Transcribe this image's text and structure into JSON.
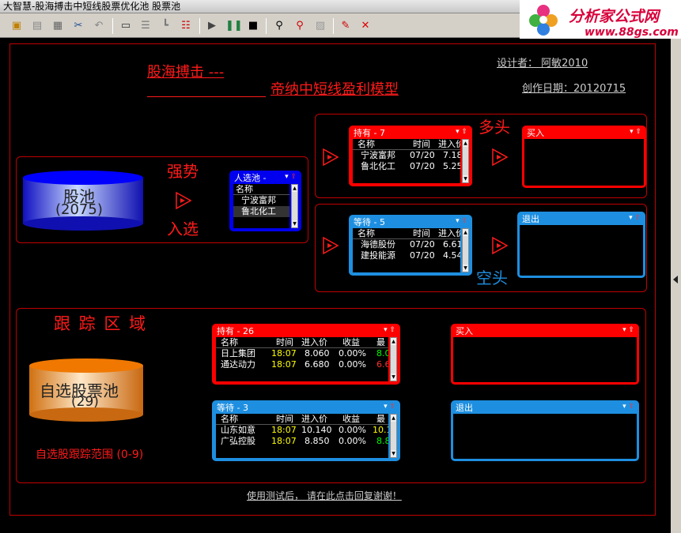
{
  "window": {
    "title": "大智慧-股海搏击中短线股票优化池 股票池"
  },
  "logo": {
    "name": "分析家公式网",
    "url": "www.88gs.com"
  },
  "header": {
    "title_line1": "股海搏击 ---",
    "title_line2": "帝纳中短线盈利模型",
    "designer": "设计者： 阿敏2010",
    "created": "创作日期：20120715"
  },
  "pool": {
    "name": "股池",
    "count": "(2075)",
    "strong_label": "强势",
    "enter_label": "入选"
  },
  "selected_panel": {
    "title": "人选池 -",
    "header": "名称",
    "rows": [
      "宁波富邦",
      "鲁北化工"
    ]
  },
  "long_label": "多头",
  "short_label": "空头",
  "hold_panel": {
    "title": "持有 - 7",
    "headers": [
      "名称",
      "时间",
      "进入价"
    ],
    "rows": [
      [
        "宁波富邦",
        "07/20",
        "7.18"
      ],
      [
        "鲁北化工",
        "07/20",
        "5.25"
      ]
    ]
  },
  "wait_panel": {
    "title": "等待 - 5",
    "headers": [
      "名称",
      "时间",
      "进入价"
    ],
    "rows": [
      [
        "海德股份",
        "07/20",
        "6.61"
      ],
      [
        "建投能源",
        "07/20",
        "4.54"
      ]
    ]
  },
  "buy_panel": {
    "title": "买入"
  },
  "exit_panel": {
    "title": "退出"
  },
  "tracking": {
    "title": "跟 踪 区 域",
    "pool_name": "自选股票池",
    "pool_count": "(29)",
    "range_label": "自选股跟踪范围 (0-9)",
    "hold_panel": {
      "title": "持有 - 26",
      "headers": [
        "名称",
        "时间",
        "进入价",
        "收益",
        "最"
      ],
      "rows": [
        [
          "日上集团",
          "18:07",
          "8.060",
          "0.00%",
          "8.0"
        ],
        [
          "通达动力",
          "18:07",
          "6.680",
          "0.00%",
          "6.6"
        ]
      ]
    },
    "wait_panel": {
      "title": "等待 - 3",
      "headers": [
        "名称",
        "时间",
        "进入价",
        "收益",
        "最"
      ],
      "rows": [
        [
          "山东如意",
          "18:07",
          "10.140",
          "0.00%",
          "10.1"
        ],
        [
          "广弘控股",
          "18:07",
          "8.850",
          "0.00%",
          "8.8"
        ]
      ]
    },
    "buy_panel": {
      "title": "买入"
    },
    "exit_panel": {
      "title": "退出"
    }
  },
  "footer": {
    "reply_link": "使用测试后， 请在此点击回复谢谢！"
  },
  "colors": {
    "red": "#ff0000",
    "blue": "#1e8fe0",
    "navy": "#0000ee",
    "yellow": "#ffff00",
    "green": "#00ff00"
  }
}
